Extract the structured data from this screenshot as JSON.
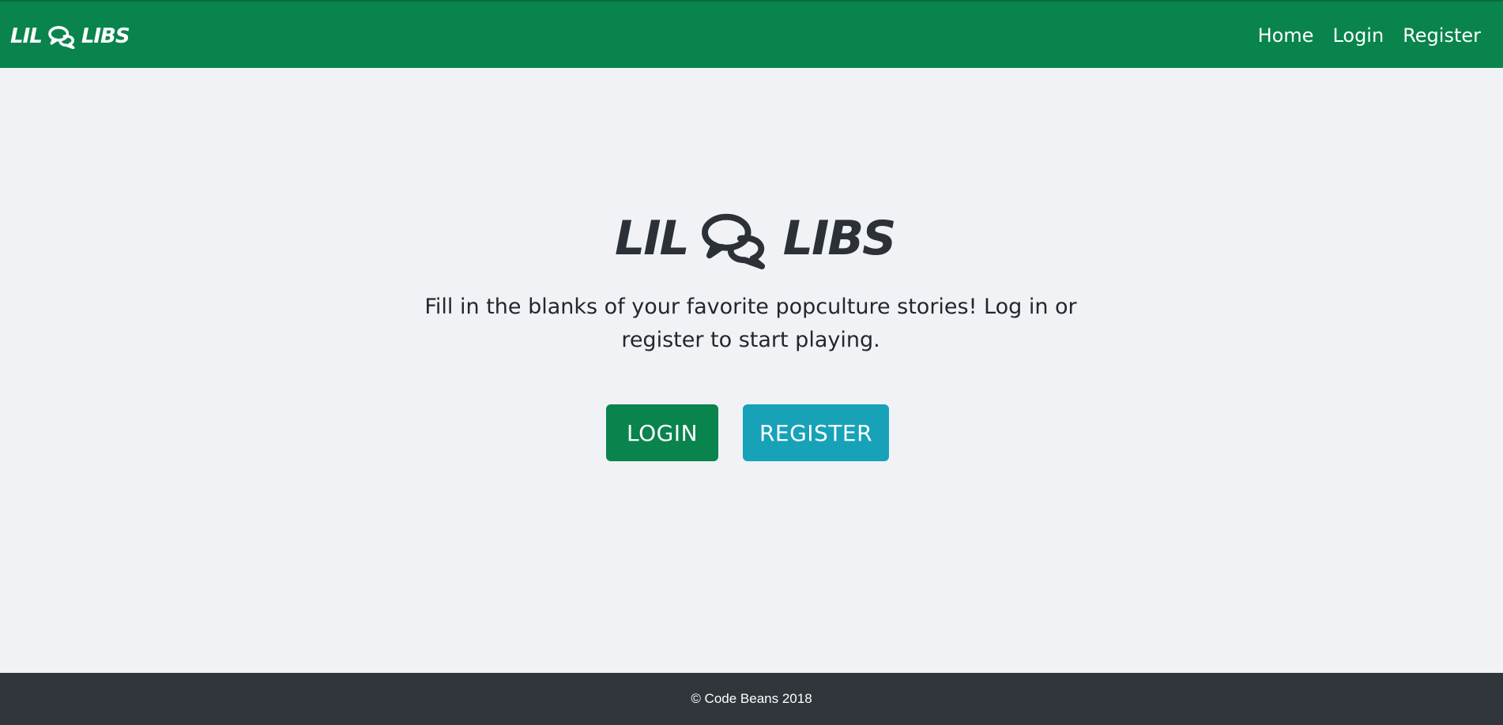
{
  "colors": {
    "navbar_bg": "#09844d",
    "page_bg": "#f0f2f5",
    "login_button_bg": "#09844d",
    "register_button_bg": "#17a2b8",
    "footer_bg": "#30363b",
    "logo_text": "#2b3137"
  },
  "navbar": {
    "brand": {
      "left_word": "LIL",
      "right_word": "LIBS",
      "icon": "speech-bubbles-icon"
    },
    "links": [
      {
        "label": "Home"
      },
      {
        "label": "Login"
      },
      {
        "label": "Register"
      }
    ]
  },
  "hero": {
    "logo": {
      "left_word": "LIL",
      "right_word": "LIBS",
      "icon": "speech-bubbles-icon"
    },
    "tagline": "Fill in the blanks of your favorite popculture stories! Log in or register to start playing.",
    "buttons": {
      "login_label": "LOGIN",
      "register_label": "REGISTER"
    }
  },
  "footer": {
    "text": "© Code Beans 2018"
  }
}
